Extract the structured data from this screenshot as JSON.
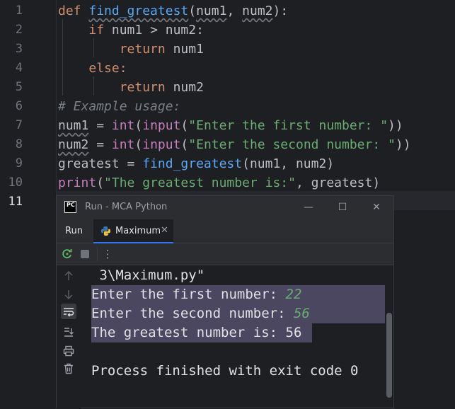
{
  "editor": {
    "line_numbers": [
      "1",
      "2",
      "3",
      "4",
      "5",
      "6",
      "7",
      "8",
      "9",
      "10",
      "11"
    ],
    "lines": {
      "l1": {
        "def": "def",
        "fn": "find_greatest",
        "open": "(",
        "p1": "num1",
        "comma": ", ",
        "p2": "num2",
        "close": "):"
      },
      "l2": {
        "if": "if",
        "cond": " num1 > num2:"
      },
      "l3": {
        "ret": "return",
        "val": " num1"
      },
      "l4": {
        "else": "else:"
      },
      "l5": {
        "ret": "return",
        "val": " num2"
      },
      "l6": {
        "comment": "# Example usage:"
      },
      "l7": {
        "var": "num1",
        "eq": " = ",
        "int": "int",
        "p": "(",
        "input": "input",
        "p2": "(",
        "str": "\"Enter the first number: \"",
        "close": "))"
      },
      "l8": {
        "var": "num2",
        "eq": " = ",
        "int": "int",
        "p": "(",
        "input": "input",
        "p2": "(",
        "str": "\"Enter the second number: \"",
        "close": "))"
      },
      "l9": {
        "var": "greatest",
        "eq": " = ",
        "fn": "find_greatest",
        "args": "(num1, num2)"
      },
      "l10": {
        "print": "print",
        "p": "(",
        "str": "\"The greatest number is:\"",
        "rest": ", greatest)"
      }
    }
  },
  "run_window": {
    "title": "Run - MCA Python",
    "logo_text": "PC",
    "minimize": "—",
    "maximize": "☐",
    "close": "✕",
    "run_label": "Run",
    "tab_label": "Maximum",
    "tab_close": "✕",
    "menu": "⋮",
    "console": {
      "path_tail": " 3\\Maximum.py\"",
      "prompt1": "Enter the first number: ",
      "input1": "22",
      "prompt2": "Enter the second number: ",
      "input2": "56",
      "result": "The greatest number is: 56",
      "finished": "Process finished with exit code 0"
    }
  },
  "colors": {
    "background": "#1e1f22",
    "keyword": "#cf8e6d",
    "function": "#56a8f5",
    "builtin": "#c77dbb",
    "string": "#6aab73",
    "selection": "#4b4761",
    "accent": "#3574f0"
  },
  "icons": [
    "rerun-icon",
    "stop-icon",
    "more-icon",
    "scroll-up-icon",
    "scroll-down-icon",
    "soft-wrap-icon",
    "scroll-to-end-icon",
    "print-icon",
    "trash-icon",
    "python-icon",
    "pycharm-logo-icon"
  ]
}
